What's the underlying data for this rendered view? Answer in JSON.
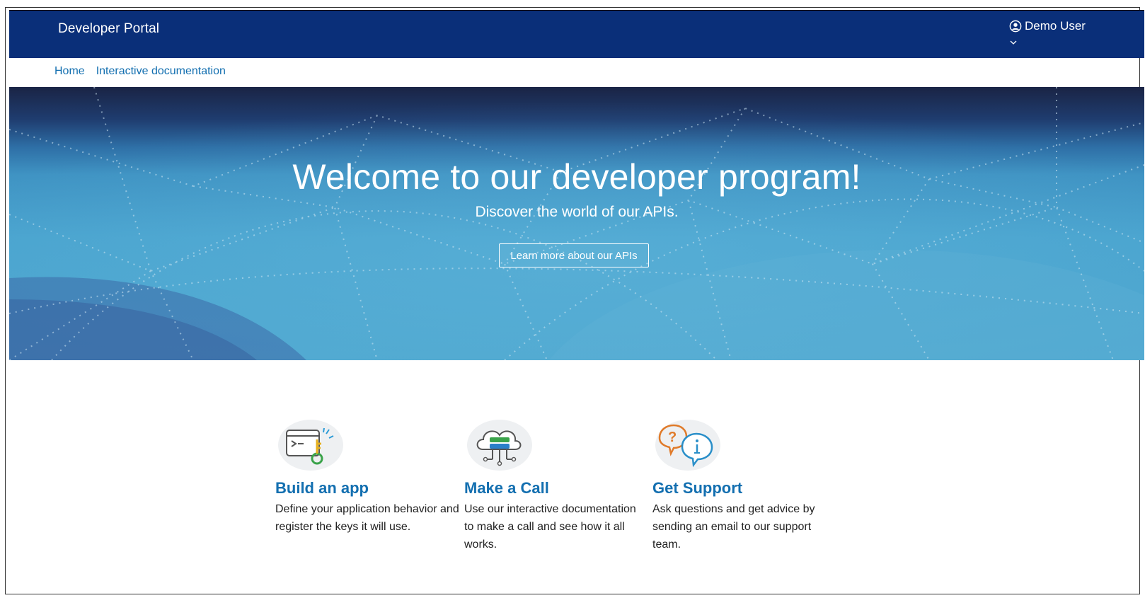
{
  "header": {
    "brand": "Developer Portal",
    "user_name": "Demo User",
    "user_icon": "user-circle-icon",
    "menu_icon": "chevron-down-icon"
  },
  "breadcrumb": {
    "items": [
      "Home",
      "Interactive documentation"
    ]
  },
  "hero": {
    "title": "Welcome to our developer program!",
    "subtitle": "Discover the world of our APIs.",
    "button_label": "Learn more about our APIs"
  },
  "features": [
    {
      "icon": "terminal-key-icon",
      "title": "Build an app",
      "description": "Define your application behavior and register the keys it will use."
    },
    {
      "icon": "cloud-api-icon",
      "title": "Make a Call",
      "description": "Use our interactive documentation to make a call and see how it all works."
    },
    {
      "icon": "support-chat-icon",
      "title": "Get Support",
      "description": "Ask questions and get advice by sending an email to our support team."
    }
  ],
  "colors": {
    "header_bg": "#0a2f79",
    "link": "#136fb0",
    "hero_top": "#1a2445",
    "hero_bottom": "#4fa8d0"
  }
}
